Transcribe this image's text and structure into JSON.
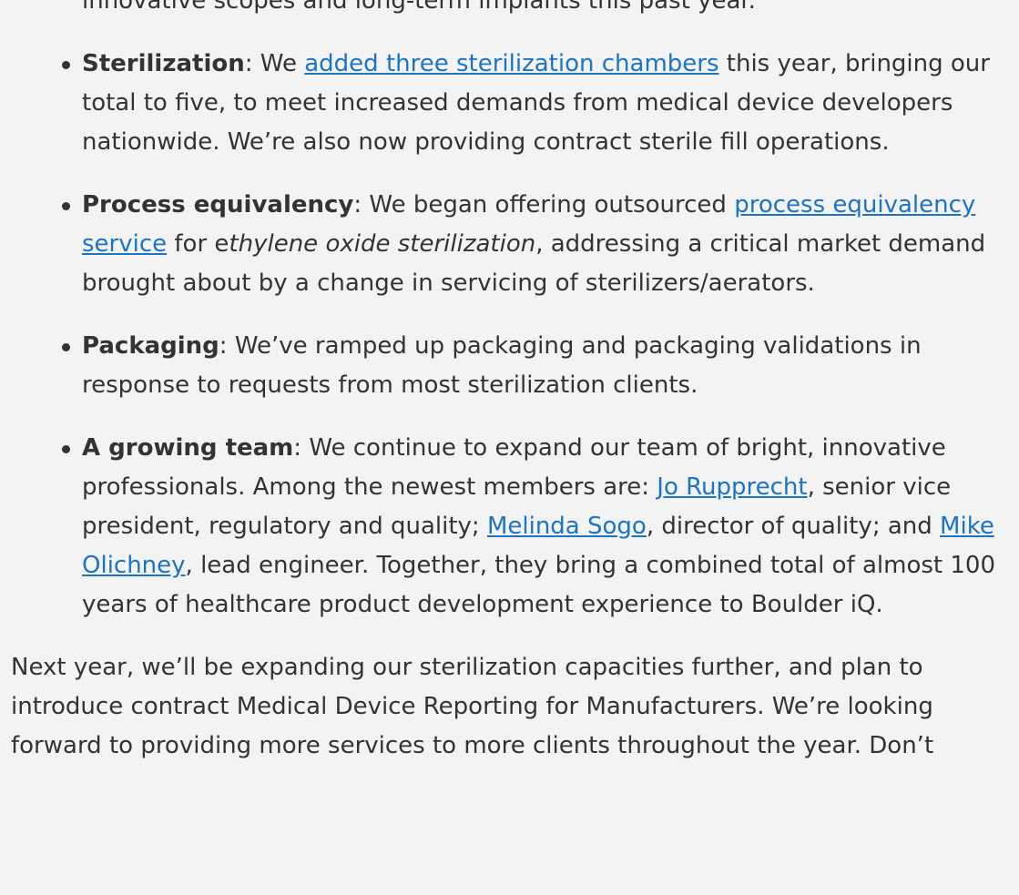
{
  "intro": {
    "text": "innovative scopes and long-term implants this past year."
  },
  "bullets": [
    {
      "title": "Sterilization",
      "sep": ": ",
      "pre": "We ",
      "link": "added three sterilization chambers",
      "post": " this year, bringing our total to five, to meet increased demands from medical device developers nationwide. We’re also now providing contract sterile fill operations."
    },
    {
      "title": "Process equivalency",
      "sep": ": ",
      "pre": "We began offering outsourced ",
      "link": "process equivalency service",
      "mid": " for e",
      "em": "thylene oxide sterilization",
      "post": ", addressing a critical market demand brought about by a change in servicing of sterilizers/aerators."
    },
    {
      "title": "Packaging",
      "sep": ": ",
      "text": "We’ve ramped up packaging and packaging validations in response to requests from most sterilization clients."
    },
    {
      "title": "A growing team",
      "sep": ": ",
      "pre": "We continue to expand our team of bright, innovative professionals. Among the newest members are: ",
      "link1": "Jo Rupprecht",
      "mid1": ", senior vice president, regulatory and quality; ",
      "link2": "Melinda Sogo",
      "mid2": ", director of quality; and ",
      "link3": "Mike Olichney",
      "post": ", lead engineer. Together, they bring a combined total of almost 100 years of healthcare product development experience to Boulder iQ."
    }
  ],
  "outro": {
    "text": "Next year, we’ll be expanding our sterilization capacities further, and plan to introduce contract Medical Device Reporting for Manufacturers. We’re looking forward to providing more services to more clients throughout the year. Don’t"
  },
  "colors": {
    "background": "#f3f3f3",
    "text": "#333333",
    "link": "#1b74c5"
  }
}
